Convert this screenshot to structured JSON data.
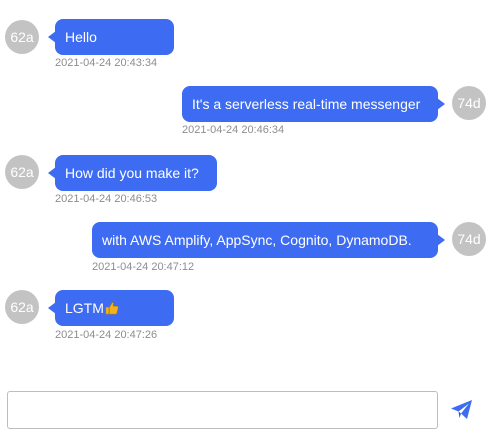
{
  "messages": [
    {
      "avatar": "62a",
      "text": "Hello",
      "time": "2021-04-24 20:43:34"
    },
    {
      "avatar": "74d",
      "text": "It's a serverless real-time messenger",
      "time": "2021-04-24 20:46:34"
    },
    {
      "avatar": "62a",
      "text": "How did you make it?",
      "time": "2021-04-24 20:46:53"
    },
    {
      "avatar": "74d",
      "text": "with AWS Amplify, AppSync, Cognito, DynamoDB.",
      "time": "2021-04-24 20:47:12"
    },
    {
      "avatar": "62a",
      "text": "LGTM",
      "time": "2021-04-24 20:47:26"
    }
  ],
  "composer": {
    "value": "",
    "placeholder": ""
  },
  "icons": {
    "send": "paper-plane-icon",
    "reaction": "thumbs-up-icon"
  },
  "colors": {
    "bubble": "#3d6cf2",
    "avatar": "#c3c3c3",
    "send_icon": "#3d6cf2"
  }
}
